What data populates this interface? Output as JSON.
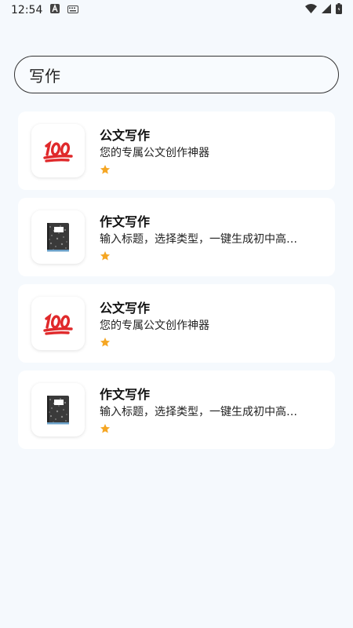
{
  "status_bar": {
    "time": "12:54",
    "left_icons": [
      "notification-a-icon",
      "keyboard-icon"
    ],
    "right_icons": [
      "wifi-icon",
      "signal-icon",
      "battery-icon"
    ]
  },
  "search": {
    "value": "写作",
    "placeholder": ""
  },
  "results": [
    {
      "title": "公文写作",
      "description": "您的专属公文创作神器",
      "icon": "hundred-points-icon",
      "rating": 1
    },
    {
      "title": "作文写作",
      "description": "输入标题，选择类型，一键生成初中高…",
      "icon": "notebook-icon",
      "rating": 1
    },
    {
      "title": "公文写作",
      "description": "您的专属公文创作神器",
      "icon": "hundred-points-icon",
      "rating": 1
    },
    {
      "title": "作文写作",
      "description": "输入标题，选择类型，一键生成初中高…",
      "icon": "notebook-icon",
      "rating": 1
    }
  ],
  "colors": {
    "background": "#f5f9fd",
    "card": "#ffffff",
    "star": "#f5a623",
    "hundred_red": "#e0292b"
  }
}
